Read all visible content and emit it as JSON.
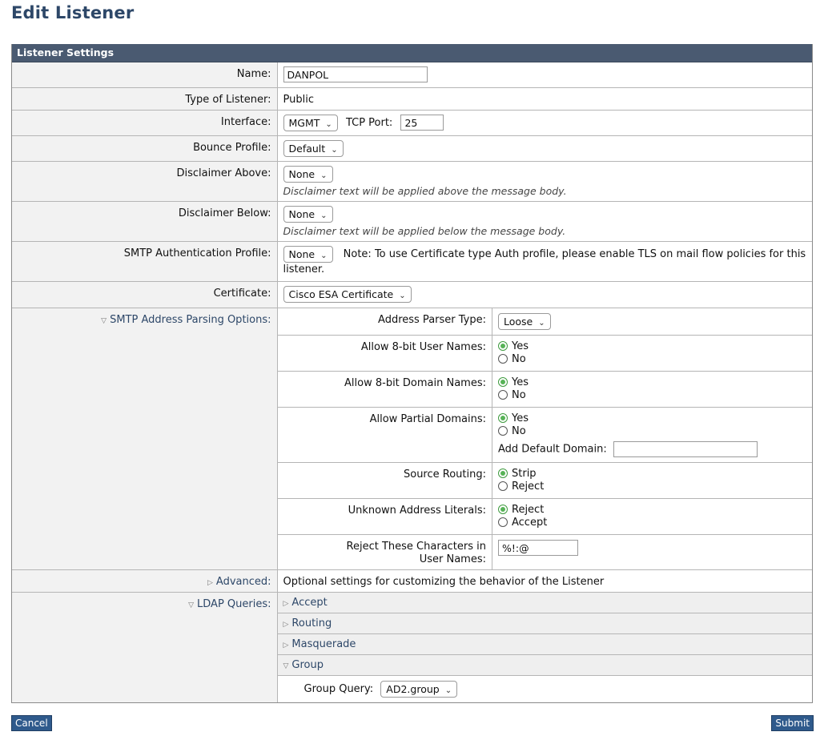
{
  "page": {
    "title": "Edit Listener"
  },
  "section": {
    "title": "Listener Settings"
  },
  "fields": {
    "name": {
      "label": "Name:",
      "value": "DANPOL"
    },
    "type": {
      "label": "Type of Listener:",
      "value": "Public"
    },
    "interface": {
      "label": "Interface:",
      "selected": "MGMT",
      "tcp_label": "TCP Port:",
      "tcp_value": "25"
    },
    "bounce": {
      "label": "Bounce Profile:",
      "selected": "Default"
    },
    "disclaimer_above": {
      "label": "Disclaimer Above:",
      "selected": "None",
      "hint": "Disclaimer text will be applied above the message body."
    },
    "disclaimer_below": {
      "label": "Disclaimer Below:",
      "selected": "None",
      "hint": "Disclaimer text will be applied below the message body."
    },
    "smtp_auth": {
      "label": "SMTP Authentication Profile:",
      "selected": "None",
      "note": "Note: To use Certificate type Auth profile, please enable TLS on mail flow policies for this listener."
    },
    "certificate": {
      "label": "Certificate:",
      "selected": "Cisco ESA Certificate"
    }
  },
  "parsing": {
    "label": "SMTP Address Parsing Options:",
    "parser_type": {
      "label": "Address Parser Type:",
      "selected": "Loose"
    },
    "user_names": {
      "label": "Allow 8-bit User Names:",
      "opt1": "Yes",
      "opt2": "No"
    },
    "domain_names": {
      "label": "Allow 8-bit Domain Names:",
      "opt1": "Yes",
      "opt2": "No"
    },
    "partial_domains": {
      "label": "Allow Partial Domains:",
      "opt1": "Yes",
      "opt2": "No",
      "default_domain_label": "Add Default Domain:",
      "default_domain_value": ""
    },
    "source_routing": {
      "label": "Source Routing:",
      "opt1": "Strip",
      "opt2": "Reject"
    },
    "address_literals": {
      "label": "Unknown Address Literals:",
      "opt1": "Reject",
      "opt2": "Accept"
    },
    "reject_chars": {
      "label": "Reject These Characters in User Names:",
      "value": "%!:@"
    }
  },
  "advanced": {
    "label": "Advanced:",
    "desc": "Optional settings for customizing the behavior of the Listener"
  },
  "ldap": {
    "label": "LDAP Queries:",
    "accept": "Accept",
    "routing": "Routing",
    "masquerade": "Masquerade",
    "group": "Group",
    "group_query_label": "Group Query:",
    "group_query_selected": "AD2.group"
  },
  "buttons": {
    "cancel": "Cancel",
    "submit": "Submit"
  }
}
